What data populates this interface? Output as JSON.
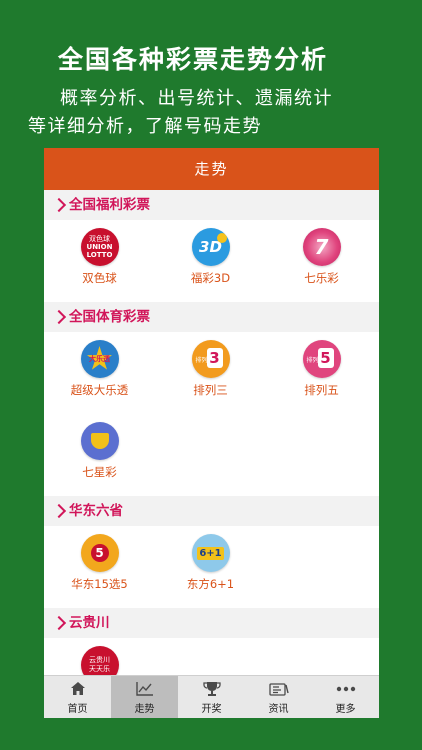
{
  "promo": {
    "title": "全国各种彩票走势分析",
    "line1": "概率分析、出号统计、遗漏统计",
    "line2": "等详细分析，了解号码走势"
  },
  "nav": {
    "title": "走势"
  },
  "sections": [
    {
      "title": "全国福利彩票",
      "items": [
        {
          "label": "双色球",
          "icon": "union-lotto-icon"
        },
        {
          "label": "福彩3D",
          "icon": "fucai-3d-icon"
        },
        {
          "label": "七乐彩",
          "icon": "qilecai-icon"
        }
      ]
    },
    {
      "title": "全国体育彩票",
      "items": [
        {
          "label": "超级大乐透",
          "icon": "daletou-icon"
        },
        {
          "label": "排列三",
          "icon": "pailie-3-icon"
        },
        {
          "label": "排列五",
          "icon": "pailie-5-icon"
        },
        {
          "label": "七星彩",
          "icon": "qixingcai-icon"
        }
      ]
    },
    {
      "title": "华东六省",
      "items": [
        {
          "label": "华东15选5",
          "icon": "huadong-15x5-icon"
        },
        {
          "label": "东方6+1",
          "icon": "dongfang-6plus1-icon"
        }
      ]
    },
    {
      "title": "云贵川",
      "items": [
        {
          "label": "",
          "icon": "yunguichuan-icon"
        }
      ]
    }
  ],
  "icon_text": {
    "ssq_top": "双色球",
    "ssq_mid": "UNION",
    "ssq_bot": "LOTTO",
    "fc3d": "3D",
    "qlc": "7",
    "dlt": "大乐透",
    "pl_tag": "排列",
    "pl3_num": "3",
    "pl5_num": "5",
    "hd_num": "5",
    "df": "6+1",
    "ygc_1": "云贵川",
    "ygc_2": "天天乐"
  },
  "tabs": [
    {
      "label": "首页",
      "icon": "home-icon",
      "active": false
    },
    {
      "label": "走势",
      "icon": "trend-chart-icon",
      "active": true
    },
    {
      "label": "开奖",
      "icon": "trophy-icon",
      "active": false
    },
    {
      "label": "资讯",
      "icon": "news-icon",
      "active": false
    },
    {
      "label": "更多",
      "icon": "more-dots-icon",
      "active": false
    }
  ],
  "colors": {
    "background": "#1f7a2d",
    "nav_bar": "#d9531a",
    "section_title": "#d1165a",
    "item_label": "#d9531a"
  }
}
